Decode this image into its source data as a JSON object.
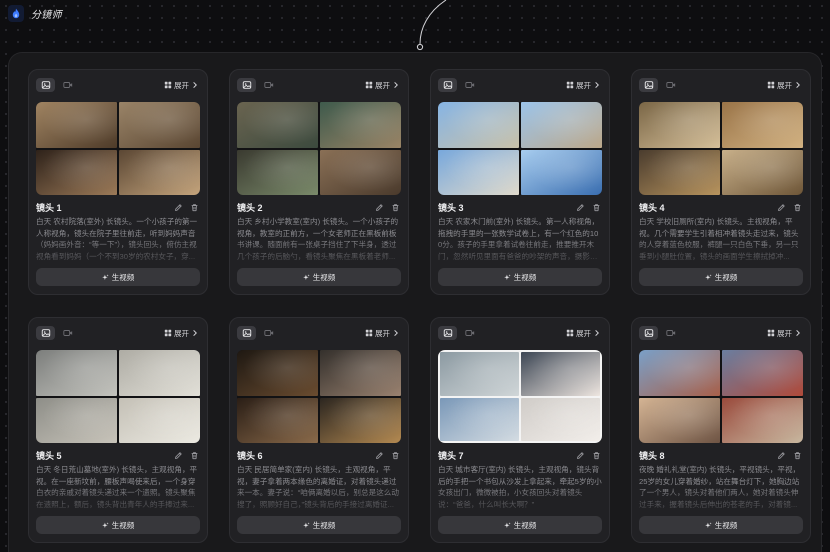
{
  "app": {
    "title": "分镜师",
    "logo_icon": "flame-logo-icon"
  },
  "theme": {
    "logo_blue": "#3d7bff",
    "selection_border": "#f4f4f4"
  },
  "card_ui": {
    "expand_label": "展开",
    "generate_label": "生视频",
    "icons": {
      "image_mode": "image-mode-icon",
      "video_mode": "video-mode-icon",
      "expand": "grid-icon",
      "expand_arrow": "chevron-right-icon",
      "edit": "edit-icon",
      "delete": "delete-icon",
      "generate": "sparkle-icon"
    }
  },
  "cards": [
    {
      "title": "镜头 1",
      "description": "白天 农村院落(室外) 长镜头。一个小孩子的第一人称视角，镜头在院子里往前走，听到妈妈声音（妈妈画外音：“等一下”），镜头回头，俯仿主视视角看到妈妈（一个不到30岁的农村女子，穿...",
      "selected": false,
      "frame_colors": [
        [
          "#a08462",
          "#4e3b29"
        ],
        [
          "#9a8468",
          "#5a4632"
        ],
        [
          "#2e221a",
          "#9c7a58"
        ],
        [
          "#5b4734",
          "#c4a47c"
        ]
      ]
    },
    {
      "title": "镜头 2",
      "description": "白天 乡村小学教室(室内) 长镜头。一个小孩子的视角，教室的正前方，一个女老师正在黑板前板书讲课。随面前有一张桌子挡住了下半身，透过几个孩子的后脑勺，看镜头聚焦在黑板着老师...",
      "selected": false,
      "frame_colors": [
        [
          "#6a6450",
          "#3c4a3e"
        ],
        [
          "#3e5a4c",
          "#9a8466"
        ],
        [
          "#3a3a30",
          "#7a8a6a"
        ],
        [
          "#8a7056",
          "#4a3a2c"
        ]
      ]
    },
    {
      "title": "镜头 3",
      "description": "白天 农家木门前(室外) 长镜头。第一人称视角，拖拽的手里的一张数学试卷上，有一个红色的100分。孩子的手里拿着试卷往前走，推要推开木门，忽然听见里面有爸爸的吵架的声音，摄影机停...",
      "selected": false,
      "frame_colors": [
        [
          "#86b4e4",
          "#c9c2aa"
        ],
        [
          "#9cc4ea",
          "#bca88a"
        ],
        [
          "#78a8dc",
          "#e0dacb"
        ],
        [
          "#a8cdef",
          "#3a6eb0"
        ]
      ]
    },
    {
      "title": "镜头 4",
      "description": "白天 学校旧厕所(室内) 长镜头。主视视角，平视。几个需要学生引着相冲着镜头走过来，镜头的人穿着蓝色校服，裤腿一只白色下垂，另一只垂到小腿肚位置，镜头的画面学生擦拭掉冲...",
      "selected": false,
      "frame_colors": [
        [
          "#7a6646",
          "#d6c09a"
        ],
        [
          "#9a7448",
          "#d2b282"
        ],
        [
          "#4a3c2e",
          "#b8945e"
        ],
        [
          "#c8b08a",
          "#6e5638"
        ]
      ]
    },
    {
      "title": "镜头 5",
      "description": "白天 冬日荒山墓地(室外) 长镜头，主观视角，平视。在一座新坟前，腰板声喝使来后，一个身穿白衣的亲戚对着镜头递过来一个遗照。镜头聚焦在遗照上，额后，镜头背出青年人的手捧过来...",
      "selected": false,
      "frame_colors": [
        [
          "#7c7e7c",
          "#c4c4be"
        ],
        [
          "#aeaca4",
          "#e2e0d8"
        ],
        [
          "#8e8e88",
          "#c8c4ba"
        ],
        [
          "#c4c0b6",
          "#eceae2"
        ]
      ]
    },
    {
      "title": "镜头 6",
      "description": "白天 民居简单家(室内) 长镜头，主观视角，平视，妻子拿着两本缘色的离婚证，对着镜头递过来一本。妻子说：“咱俩离婚以后，别总是这么动搜了，照顾好自己，”镜头背后的手接过离婚证...",
      "selected": false,
      "frame_colors": [
        [
          "#1e1812",
          "#6a4c30"
        ],
        [
          "#34302c",
          "#9a8270"
        ],
        [
          "#2a1e16",
          "#8a6a4a"
        ],
        [
          "#2c2620",
          "#b48a52"
        ]
      ]
    },
    {
      "title": "镜头 7",
      "description": "白天 城市客厅(室内) 长镜头，主观视角，镜头背后的手把一个书包从沙发上拿起来，牵起5岁的小女孩出门，微微被拍，小女孩回头对着镜头说：“爸爸，什么叫长大啊？”",
      "selected": true,
      "frame_colors": [
        [
          "#8c9aa2",
          "#d0d6d8"
        ],
        [
          "#3c4654",
          "#eee6e0"
        ],
        [
          "#7a98b8",
          "#d4dce2"
        ],
        [
          "#d0ccc8",
          "#f2eeea"
        ]
      ]
    },
    {
      "title": "镜头 8",
      "description": "夜晚 婚礼礼堂(室内) 长镜头，平视镜头，平视，25岁的女儿穿着婚纱，站在舞台灯下，她胸边站了一个男人，镜头对着他们两人，她对着镜头伸过手来，握着镜头后伸出的苍老的手，对着镜...",
      "selected": false,
      "frame_colors": [
        [
          "#7aa0c8",
          "#a8604a"
        ],
        [
          "#6a7ea0",
          "#b04a3a"
        ],
        [
          "#d4b494",
          "#6e5444"
        ],
        [
          "#9a4a3c",
          "#c8b8a0"
        ]
      ]
    }
  ]
}
